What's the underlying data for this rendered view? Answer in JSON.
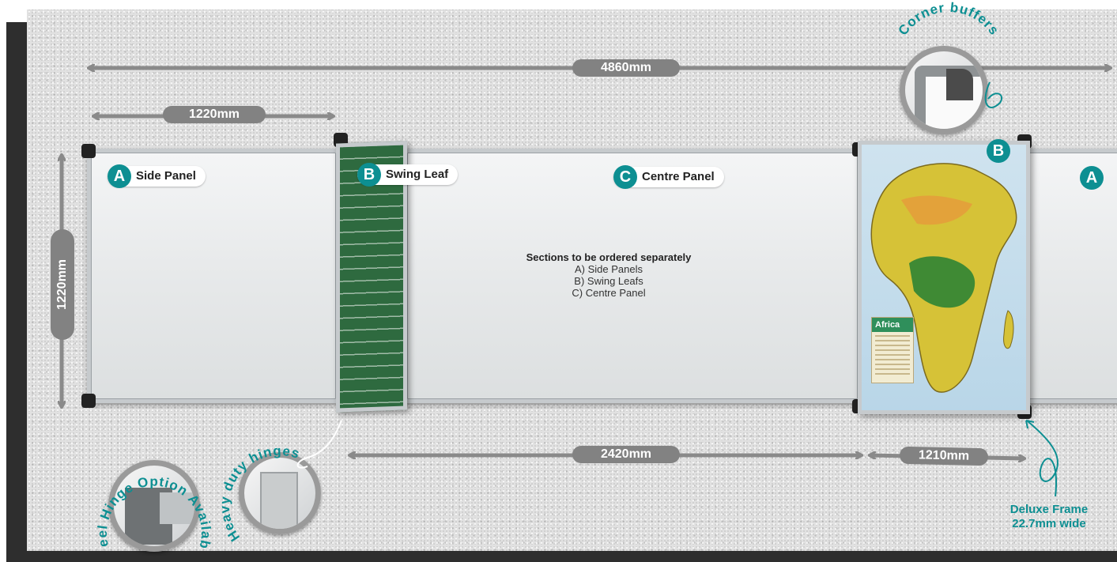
{
  "dimensions": {
    "total_width": "4860mm",
    "side_panel_width": "1220mm",
    "height": "1220mm",
    "centre_width": "2420mm",
    "swing_width": "1210mm"
  },
  "labels": {
    "side_panel": {
      "letter": "A",
      "text": "Side Panel"
    },
    "swing_leaf": {
      "letter": "B",
      "text": "Swing Leaf"
    },
    "centre_panel": {
      "letter": "C",
      "text": "Centre Panel"
    },
    "right_swing_letter": "B",
    "right_side_letter": "A"
  },
  "info": {
    "heading": "Sections to be ordered separately",
    "lines": [
      "A) Side Panels",
      "B) Swing Leafs",
      "C) Centre Panel"
    ]
  },
  "callouts": {
    "corner_buffers": "Corner buffers",
    "steel_hinge": "Steel Hinge Option Available",
    "heavy_hinges": "Heavy duty hinges",
    "deluxe_frame_line1": "Deluxe Frame",
    "deluxe_frame_line2": "22.7mm wide"
  },
  "map_title": "Africa",
  "colors": {
    "accent": "#0d8f92",
    "dimension": "#828282",
    "chalk_green": "#2e6a3f"
  }
}
